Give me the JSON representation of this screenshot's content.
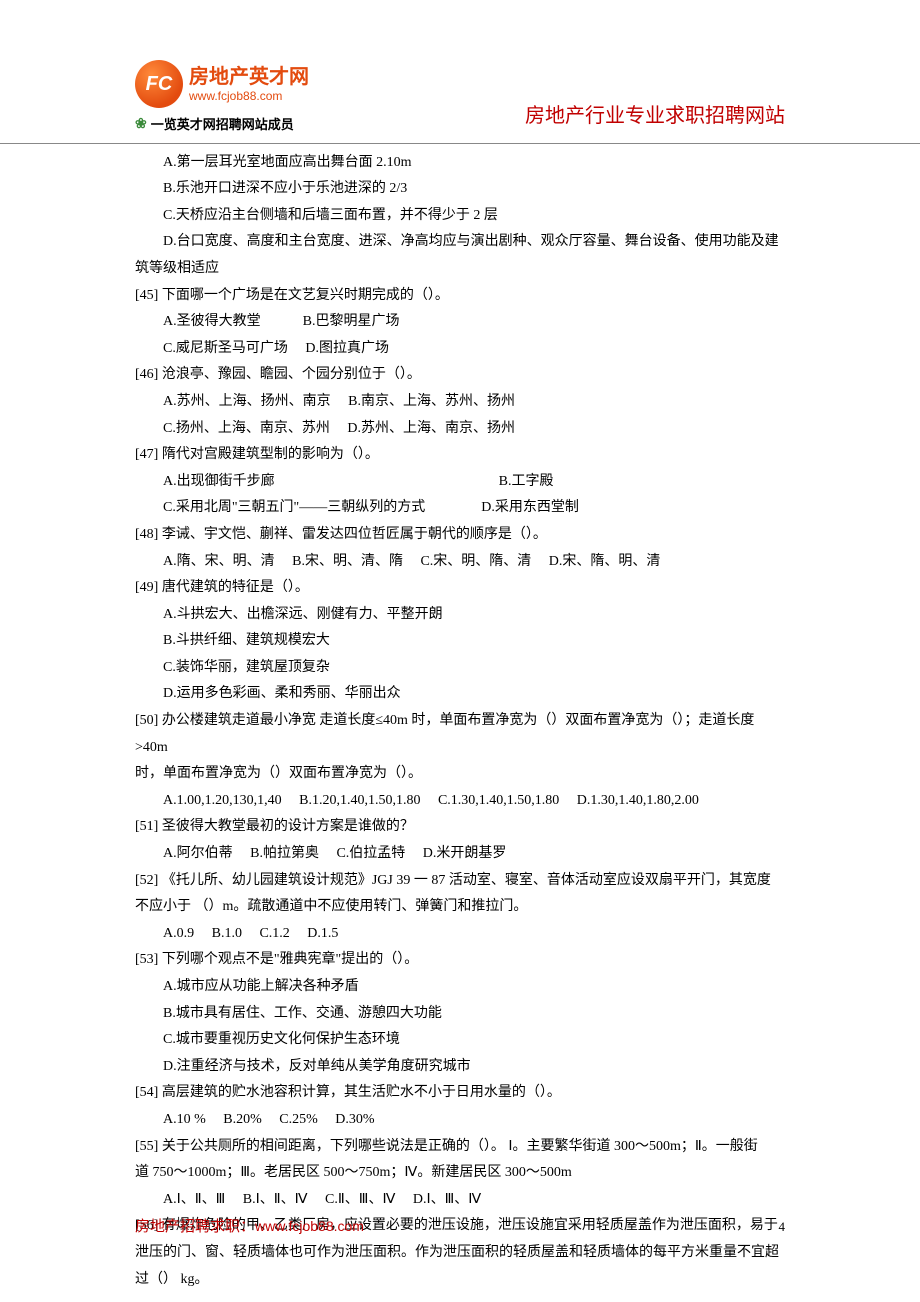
{
  "header": {
    "badge": "FC",
    "logo_cn": "房地产英才网",
    "logo_url": "www.fcjob88.com",
    "logo_sub": "一览英才网招聘网站成员",
    "title": "房地产行业专业求职招聘网站"
  },
  "lines": [
    {
      "cls": "indent",
      "text": "A.第一层耳光室地面应高出舞台面 2.10m"
    },
    {
      "cls": "indent",
      "text": "B.乐池开口进深不应小于乐池进深的 2/3"
    },
    {
      "cls": "indent",
      "text": "C.天桥应沿主台侧墙和后墙三面布置，并不得少于 2 层"
    },
    {
      "cls": "indent",
      "text": "D.台口宽度、高度和主台宽度、进深、净高均应与演出剧种、观众厅容量、舞台设备、使用功能及建"
    },
    {
      "cls": "",
      "text": "筑等级相适应"
    },
    {
      "cls": "",
      "text": "[45]  下面哪一个广场是在文艺复兴时期完成的（）。"
    },
    {
      "cls": "indent",
      "text": "A.圣彼得大教堂　　　B.巴黎明星广场"
    },
    {
      "cls": "indent",
      "text": "C.威尼斯圣马可广场　 D.图拉真广场"
    },
    {
      "cls": "",
      "text": "[46]  沧浪亭、豫园、瞻园、个园分别位于（）。"
    },
    {
      "cls": "indent",
      "text": "A.苏州、上海、扬州、南京　 B.南京、上海、苏州、扬州"
    },
    {
      "cls": "indent",
      "text": "C.扬州、上海、南京、苏州　 D.苏州、上海、南京、扬州"
    },
    {
      "cls": "",
      "text": "[47]  隋代对宫殿建筑型制的影响为（）。"
    },
    {
      "cls": "indent",
      "text": "A.出现御街千步廊　　　　　　　　　　　　　　　　B.工字殿"
    },
    {
      "cls": "indent",
      "text": "C.采用北周\"三朝五门\"——三朝纵列的方式　　　　D.采用东西堂制"
    },
    {
      "cls": "",
      "text": "[48]  李诫、宇文恺、蒯祥、雷发达四位哲匠属于朝代的顺序是（）。"
    },
    {
      "cls": "indent",
      "text": "A.隋、宋、明、清　 B.宋、明、清、隋　 C.宋、明、隋、清　 D.宋、隋、明、清"
    },
    {
      "cls": "",
      "text": "[49]  唐代建筑的特征是（）。"
    },
    {
      "cls": "indent",
      "text": "A.斗拱宏大、出檐深远、刚健有力、平整开朗"
    },
    {
      "cls": "indent",
      "text": "B.斗拱纤细、建筑规模宏大"
    },
    {
      "cls": "indent",
      "text": "C.装饰华丽，建筑屋顶复杂"
    },
    {
      "cls": "indent",
      "text": "D.运用多色彩画、柔和秀丽、华丽出众"
    },
    {
      "cls": "",
      "text": "[50]  办公楼建筑走道最小净宽 走道长度≤40m 时，单面布置净宽为（）双面布置净宽为（）；走道长度>40m"
    },
    {
      "cls": "",
      "text": "时，单面布置净宽为（）双面布置净宽为（）。"
    },
    {
      "cls": "indent",
      "text": "A.1.00,1.20,130,1,40　 B.1.20,1.40,1.50,1.80　 C.1.30,1.40,1.50,1.80　 D.1.30,1.40,1.80,2.00"
    },
    {
      "cls": "",
      "text": "[51]  圣彼得大教堂最初的设计方案是谁做的？"
    },
    {
      "cls": "indent",
      "text": "A.阿尔伯蒂　 B.帕拉第奥　 C.伯拉孟特　 D.米开朗基罗"
    },
    {
      "cls": "",
      "text": "[52]  《托儿所、幼儿园建筑设计规范》JGJ 39 一 87 活动室、寝室、音体活动室应设双扇平开门，其宽度"
    },
    {
      "cls": "",
      "text": "不应小于 （）m。疏散通道中不应使用转门、弹簧门和推拉门。"
    },
    {
      "cls": "indent",
      "text": "A.0.9　 B.1.0　 C.1.2　 D.1.5"
    },
    {
      "cls": "",
      "text": "[53]  下列哪个观点不是\"雅典宪章\"提出的（）。"
    },
    {
      "cls": "indent",
      "text": "A.城市应从功能上解决各种矛盾"
    },
    {
      "cls": "indent",
      "text": "B.城市具有居住、工作、交通、游憩四大功能"
    },
    {
      "cls": "indent",
      "text": "C.城市要重视历史文化何保护生态环境"
    },
    {
      "cls": "indent",
      "text": "D.注重经济与技术，反对单纯从美学角度研究城市"
    },
    {
      "cls": "",
      "text": "[54]  高层建筑的贮水池容积计算，其生活贮水不小于日用水量的（）。"
    },
    {
      "cls": "indent",
      "text": "A.10 %　 B.20%　 C.25%　 D.30%"
    },
    {
      "cls": "",
      "text": "[55]  关于公共厕所的相间距离，下列哪些说法是正确的（）。 Ⅰ。主要繁华街道 300～500m；Ⅱ。一般街"
    },
    {
      "cls": "",
      "text": "道 750～1000m；Ⅲ。老居民区 500～750m；Ⅳ。新建居民区 300～500m"
    },
    {
      "cls": "indent",
      "text": "A.Ⅰ、Ⅱ、Ⅲ　 B.Ⅰ、Ⅱ、Ⅳ　 C.Ⅱ、Ⅲ、Ⅳ　 D.Ⅰ、Ⅲ、Ⅳ"
    },
    {
      "cls": "",
      "text": "[56]  有爆炸危险的甲、乙类厂房，应设置必要的泄压设施，泄压设施宜采用轻质屋盖作为泄压面积，易于"
    },
    {
      "cls": "",
      "text": "泄压的门、窗、轻质墙体也可作为泄压面积。作为泄压面积的轻质屋盖和轻质墙体的每平方米重量不宜超"
    },
    {
      "cls": "",
      "text": "过（） kg。"
    }
  ],
  "footer": {
    "label": "房地产招聘求职：",
    "url": "www.fcjob88.com",
    "page": "4"
  }
}
